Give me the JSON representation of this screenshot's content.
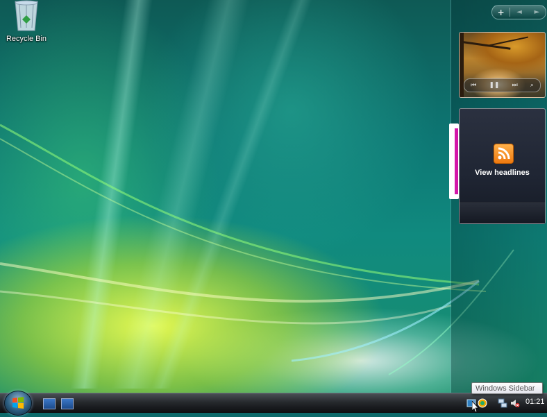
{
  "desktop": {
    "icons": [
      {
        "label": "Recycle Bin",
        "icon": "recycle-bin-icon"
      }
    ]
  },
  "sidebar": {
    "controls": {
      "add": "+",
      "prev": "◄",
      "next": "►"
    },
    "slideshow": {
      "icon": "slideshow-gadget",
      "buttons": [
        "previous-icon",
        "pause-icon",
        "next-icon",
        "view-icon"
      ]
    },
    "feed_headlines": {
      "icon": "rss-feed-icon",
      "label": "View headlines",
      "accent_color": "#d316a8"
    }
  },
  "taskbar": {
    "start_icon": "windows-start-orb",
    "quick_launch": [
      "show-desktop-icon",
      "switch-windows-icon"
    ],
    "tray": [
      "sidebar-tray-icon",
      "network-icon",
      "volume-muted-icon"
    ],
    "clock": "01:21"
  },
  "tooltip": {
    "text": "Windows Sidebar"
  }
}
